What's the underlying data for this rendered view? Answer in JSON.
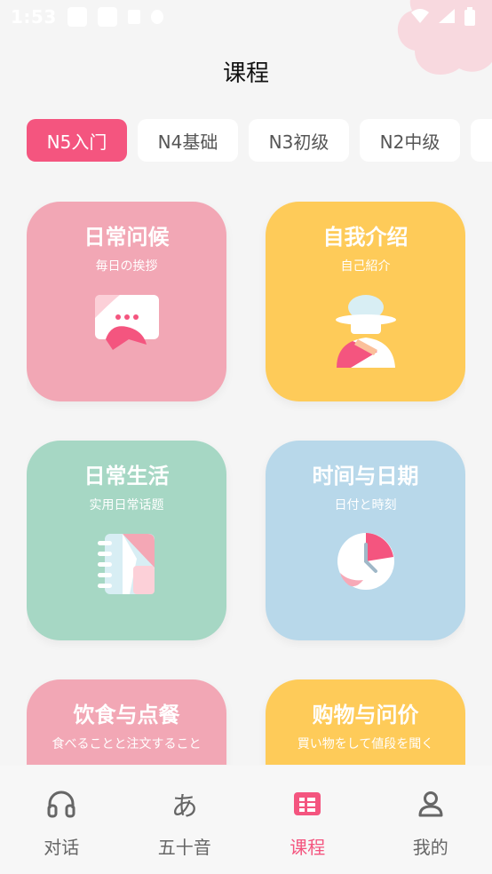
{
  "status_bar": {
    "time": "1:53"
  },
  "header": {
    "title": "课程"
  },
  "tabs": [
    {
      "label": "N5入门",
      "active": true
    },
    {
      "label": "N4基础",
      "active": false
    },
    {
      "label": "N3初级",
      "active": false
    },
    {
      "label": "N2中级",
      "active": false
    }
  ],
  "cards": [
    {
      "title": "日常问候",
      "subtitle": "毎日の挨拶",
      "icon": "chat-bubble-icon",
      "color": "#f2a7b5"
    },
    {
      "title": "自我介绍",
      "subtitle": "自己紹介",
      "icon": "person-hat-icon",
      "color": "#fecb59"
    },
    {
      "title": "日常生活",
      "subtitle": "实用日常话题",
      "icon": "notebook-icon",
      "color": "#a6d7c4"
    },
    {
      "title": "时间与日期",
      "subtitle": "日付と時刻",
      "icon": "clock-icon",
      "color": "#b8d8ea"
    },
    {
      "title": "饮食与点餐",
      "subtitle": "食べることと注文すること",
      "icon": "food-icon",
      "color": "#f2a7b5"
    },
    {
      "title": "购物与问价",
      "subtitle": "買い物をして値段を聞く",
      "icon": "shopping-icon",
      "color": "#fecb59"
    }
  ],
  "bottom_nav": [
    {
      "label": "对话",
      "icon": "headphones-icon",
      "active": false
    },
    {
      "label": "五十音",
      "icon": "hiragana-a-icon",
      "glyph": "あ",
      "active": false
    },
    {
      "label": "课程",
      "icon": "course-book-icon",
      "active": true
    },
    {
      "label": "我的",
      "icon": "person-icon",
      "active": false
    }
  ],
  "colors": {
    "accent": "#f4557f",
    "pink": "#f2a7b5",
    "yellow": "#fecb59",
    "green": "#a6d7c4",
    "blue": "#b8d8ea"
  }
}
